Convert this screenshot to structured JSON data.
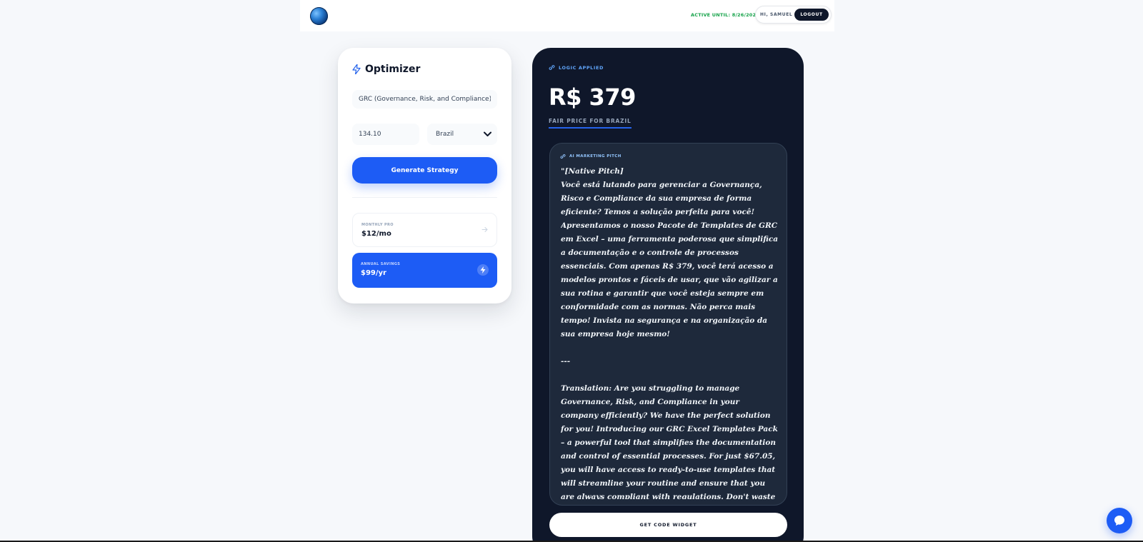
{
  "header": {
    "active_until": "ACTIVE UNTIL: 8/26/2026",
    "greeting": "HI, SAMUEL",
    "logout_label": "LOGOUT"
  },
  "optimizer": {
    "title": "Optimizer",
    "product_value": "GRC (Governance, Risk, and Compliance) Exc",
    "price_value": "134.10",
    "country_value": "Brazil",
    "generate_label": "Generate Strategy",
    "monthly": {
      "label": "MONTHLY PRO",
      "price": "$12/mo"
    },
    "annual": {
      "label": "ANNUAL SAVINGS",
      "price": "$99/yr"
    }
  },
  "result": {
    "logic_label": "LOGIC APPLIED",
    "price": "R$ 379",
    "fair_label": "FAIR PRICE FOR BRAZIL",
    "pitch_label": "AI MARKETING PITCH",
    "pitch_text": "\"[Native Pitch]\nVocê está lutando para gerenciar a Governança, Risco e Compliance da sua empresa de forma eficiente? Temos a solução perfeita para você! Apresentamos o nosso Pacote de Templates de GRC em Excel – uma ferramenta poderosa que simplifica a documentação e o controle de processos essenciais. Com apenas R$ 379, você terá acesso a modelos prontos e fáceis de usar, que vão agilizar a sua rotina e garantir que você esteja sempre em conformidade com as normas. Não perca mais tempo! Invista na segurança e na organização da sua empresa hoje mesmo!\n\n---\n\nTranslation: Are you struggling to manage Governance, Risk, and Compliance in your company efficiently? We have the perfect solution for you! Introducing our GRC Excel Templates Pack – a powerful tool that simplifies the documentation and control of essential processes. For just $67.05, you will have access to ready-to-use templates that will streamline your routine and ensure that you are always compliant with regulations. Don't waste any more time! Invest in the security and organization of your company today!\"",
    "widget_label": "GET CODE WIDGET"
  },
  "colors": {
    "accent": "#1d5cf5",
    "dark_card": "#0f172a",
    "status_green": "#16a34a"
  }
}
